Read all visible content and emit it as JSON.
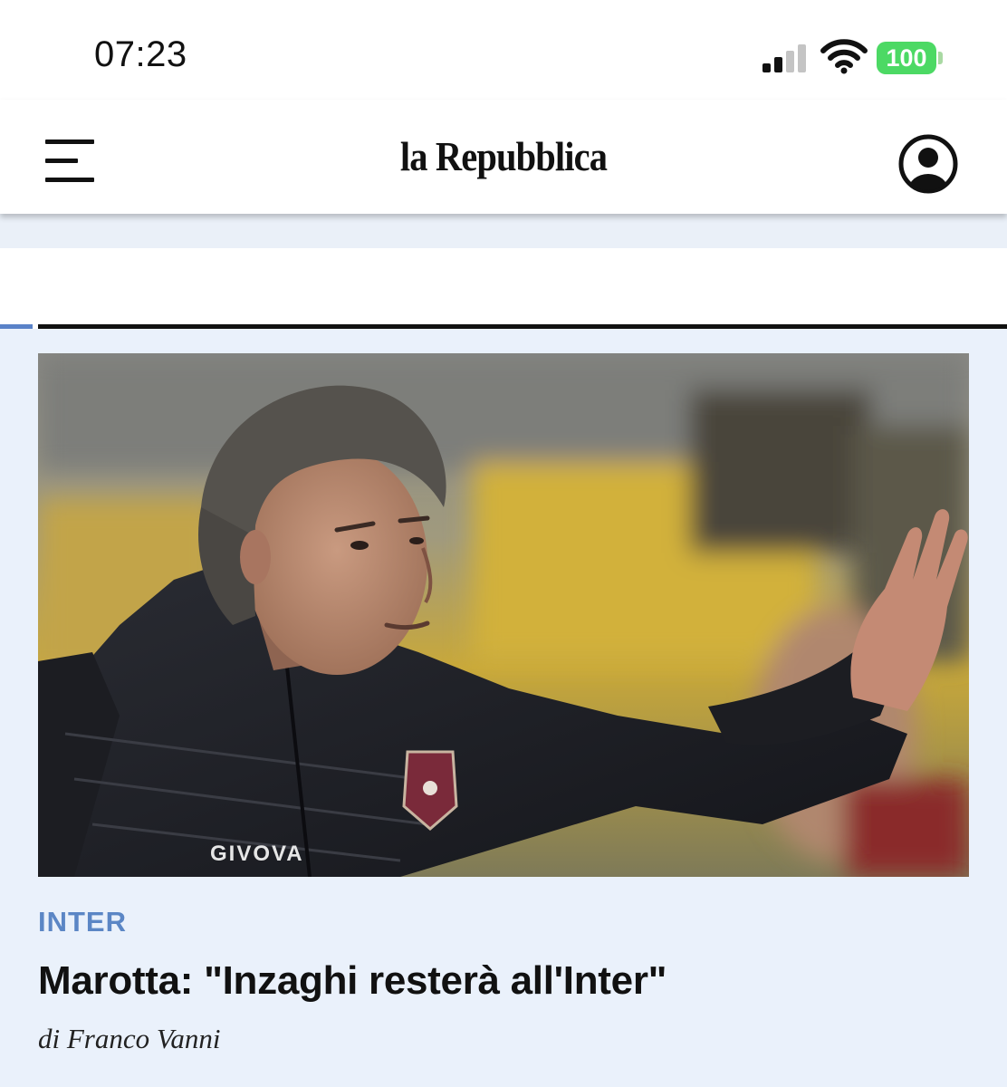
{
  "status_bar": {
    "time": "07:23",
    "battery_level": "100",
    "signal_icon": "signal-bars-icon",
    "wifi_icon": "wifi-icon",
    "battery_color": "#4cd964"
  },
  "header": {
    "logo_text": "la Repubblica",
    "menu_icon": "hamburger-menu-icon",
    "account_icon": "user-account-icon"
  },
  "theme": {
    "accent": "#5b86c5",
    "card_background": "#eaf1fb",
    "text": "#111111"
  },
  "article": {
    "image_icon": "coach-photo-image",
    "kicker": "INTER",
    "title": "Marotta: \"Inzaghi resterà all'Inter\"",
    "byline": "di Franco Vanni"
  }
}
